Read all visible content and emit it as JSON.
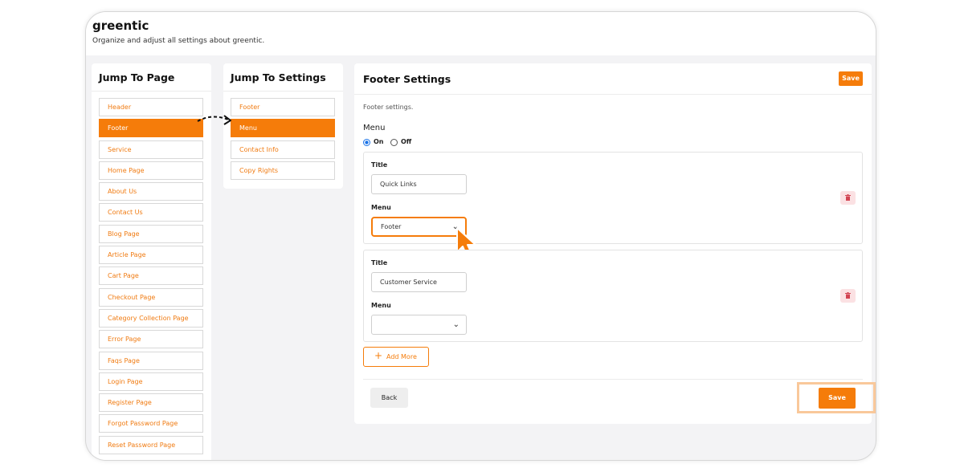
{
  "app": {
    "title": "greentic",
    "subtitle": "Organize and adjust all settings about greentic."
  },
  "jump_to_page": {
    "title": "Jump To Page",
    "items": [
      {
        "label": "Header",
        "active": false
      },
      {
        "label": "Footer",
        "active": true
      },
      {
        "label": "Service",
        "active": false
      },
      {
        "label": "Home Page",
        "active": false
      },
      {
        "label": "About Us",
        "active": false
      },
      {
        "label": "Contact Us",
        "active": false
      },
      {
        "label": "Blog Page",
        "active": false
      },
      {
        "label": "Article Page",
        "active": false
      },
      {
        "label": "Cart Page",
        "active": false
      },
      {
        "label": "Checkout Page",
        "active": false
      },
      {
        "label": "Category Collection Page",
        "active": false
      },
      {
        "label": "Error Page",
        "active": false
      },
      {
        "label": "Faqs Page",
        "active": false
      },
      {
        "label": "Login Page",
        "active": false
      },
      {
        "label": "Register Page",
        "active": false
      },
      {
        "label": "Forgot Password Page",
        "active": false
      },
      {
        "label": "Reset Password Page",
        "active": false
      }
    ]
  },
  "jump_to_settings": {
    "title": "Jump To Settings",
    "items": [
      {
        "label": "Footer",
        "active": false
      },
      {
        "label": "Menu",
        "active": true
      },
      {
        "label": "Contact Info",
        "active": false
      },
      {
        "label": "Copy Rights",
        "active": false
      }
    ]
  },
  "footer_settings": {
    "title": "Footer Settings",
    "save_top": "Save",
    "description": "Footer settings.",
    "menu_label": "Menu",
    "radio_on": "On",
    "radio_off": "Off",
    "selected_radio": "On",
    "blocks": [
      {
        "title_label": "Title",
        "title_value": "Quick Links",
        "menu_label": "Menu",
        "menu_value": "Footer",
        "focused": true
      },
      {
        "title_label": "Title",
        "title_value": "Customer Service",
        "menu_label": "Menu",
        "menu_value": "",
        "focused": false
      }
    ],
    "add_more": "Add More",
    "back": "Back",
    "save_bottom": "Save"
  },
  "colors": {
    "accent": "#f57c0a",
    "highlight": "#f9c89a",
    "trash_bg": "#fbe1e3",
    "trash_fg": "#d24452"
  },
  "icons": [
    "trash-icon",
    "plus-icon",
    "chevron-down-icon",
    "cursor-pointer-icon",
    "dashed-arrow-icon"
  ]
}
